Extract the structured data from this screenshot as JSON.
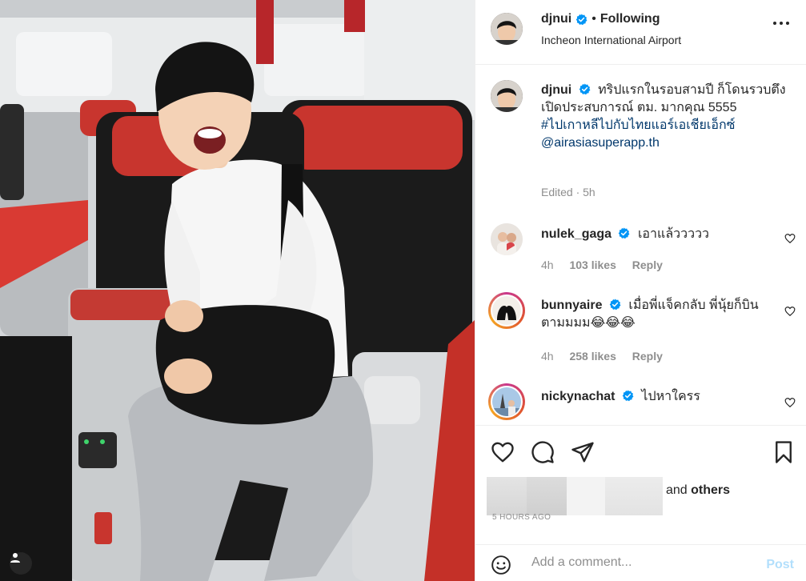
{
  "photo": {
    "alt": "Photo by djnui"
  },
  "header": {
    "username": "djnui",
    "separator": "•",
    "follow_state": "Following",
    "location": "Incheon International Airport"
  },
  "caption": {
    "username": "djnui",
    "line1": "ทริปแรกในรอบสามปี ก็โดนรวบตึง",
    "line2": "เปิดประสบการณ์ ตม. มากคุณ 5555",
    "hashtag": "#ไปเกาหลีไปกับไทยแอร์เอเชียเอ็กซ์",
    "mention": "@airasiasuperapp.th",
    "edited": "Edited · 5h"
  },
  "comments": [
    {
      "username": "nulek_gaga",
      "text": "เอาแล้ววววว",
      "time": "4h",
      "likes": "103 likes",
      "reply": "Reply"
    },
    {
      "username": "bunnyaire",
      "text": "เมื่อพี่แจ็คกลับ พี่นุ้ยก็บินตามมมม😂😂😂",
      "time": "4h",
      "likes": "258 likes",
      "reply": "Reply"
    },
    {
      "username": "nickynachat",
      "text": "ไปหาใครร"
    }
  ],
  "likes": {
    "prefix": "and",
    "others": "others"
  },
  "timestamp": "5 HOURS AGO",
  "add_comment": {
    "placeholder": "Add a comment...",
    "post_label": "Post"
  },
  "colors": {
    "verified": "#0095f6",
    "link": "#00376b",
    "post_disabled": "#b2dffc",
    "seat_red": "#c8352e"
  },
  "icons": [
    "heart-icon",
    "comment-icon",
    "share-icon",
    "bookmark-icon",
    "emoji-icon",
    "more-icon",
    "verified-icon",
    "tag-user-icon"
  ]
}
